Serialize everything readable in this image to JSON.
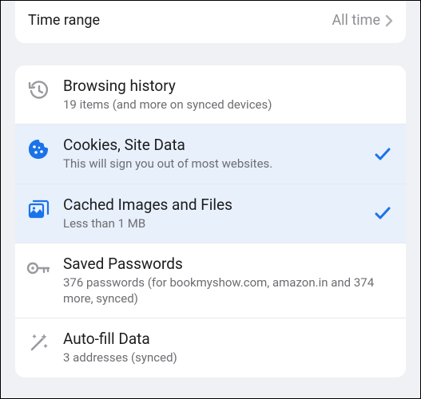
{
  "timeRange": {
    "label": "Time range",
    "value": "All time"
  },
  "items": [
    {
      "title": "Browsing history",
      "subtitle": "19 items (and more on synced devices)"
    },
    {
      "title": "Cookies, Site Data",
      "subtitle": "This will sign you out of most websites."
    },
    {
      "title": "Cached Images and Files",
      "subtitle": "Less than 1 MB"
    },
    {
      "title": "Saved Passwords",
      "subtitle": "376 passwords (for bookmyshow.com, amazon.in and 374 more, synced)"
    },
    {
      "title": "Auto-fill Data",
      "subtitle": "3 addresses (synced)"
    }
  ],
  "colors": {
    "accent": "#1a73e8",
    "muted": "#9a9a9e"
  }
}
